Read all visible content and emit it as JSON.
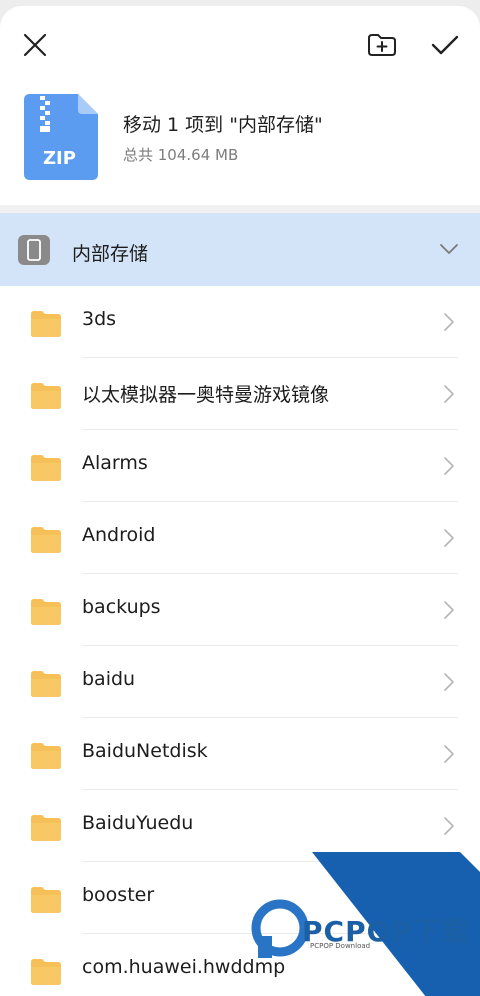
{
  "header": {
    "close_icon": "close-icon",
    "new_folder_icon": "new-folder-icon",
    "confirm_icon": "check-icon"
  },
  "summary": {
    "file_icon_label": "ZIP",
    "title": "移动 1 项到 \"内部存储\"",
    "size": "总共 104.64 MB"
  },
  "storage": {
    "label": "内部存储",
    "icon": "phone-icon",
    "expand_icon": "chevron-down-icon"
  },
  "folders": [
    {
      "name": "3ds"
    },
    {
      "name": "以太模拟器一奥特曼游戏镜像"
    },
    {
      "name": "Alarms"
    },
    {
      "name": "Android"
    },
    {
      "name": "backups"
    },
    {
      "name": "baidu"
    },
    {
      "name": "BaiduNetdisk"
    },
    {
      "name": "BaiduYuedu"
    },
    {
      "name": "booster"
    },
    {
      "name": "com.huawei.hwddmp"
    }
  ],
  "watermark": {
    "brand": "PCPOP下载",
    "sub": "PCPOP Download"
  },
  "colors": {
    "accent_bg": "#d3e4f8",
    "folder": "#f5c057",
    "zip": "#5b9cf0"
  }
}
